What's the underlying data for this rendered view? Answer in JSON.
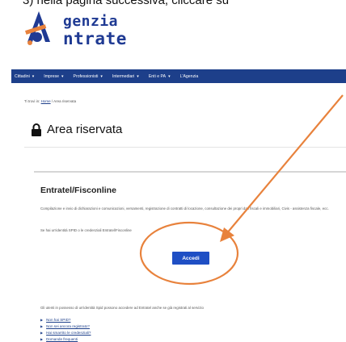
{
  "caption": "3) nella pagina successiva, cliccare su",
  "logo": {
    "line1": "genzia",
    "line2": "ntrate"
  },
  "nav": {
    "items": [
      {
        "label": "Cittadini"
      },
      {
        "label": "Imprese"
      },
      {
        "label": "Professionisti"
      },
      {
        "label": "Intermediari"
      },
      {
        "label": "Enti e PA"
      },
      {
        "label": "L'Agenzia"
      }
    ],
    "chevron": "▾"
  },
  "breadcrumb": {
    "prefix": "Ti trovi in:",
    "home": "Home",
    "separator": "/",
    "current": "Area riservata"
  },
  "page_title": "Area riservata",
  "card": {
    "title": "Entratel/Fisconline",
    "description": "Compilazione e invio di dichiarazioni e comunicazioni, versamenti, registrazione di contratti di locazione, consultazione dei propri dati fiscali e immobiliari, Civis - assistenza fiscale, ecc.",
    "note": "Se hai un'identità SPID o le credenziali Entratel/Fisconline",
    "button": "Accedi",
    "info": "Gli utenti in possesso di un'identità Spid possono accedere ad Entratel anche se già registrati al servizio",
    "links": [
      "Non hai SPID?",
      "Non sei ancora registrato?",
      "Hai smarrito le credenziali?",
      "Domande frequenti"
    ]
  },
  "annotation": {
    "color": "#e8823c"
  },
  "colors": {
    "nav_bg": "#1d3f8a",
    "button_bg": "#1f4fc4",
    "logo": "#1f3a93"
  }
}
